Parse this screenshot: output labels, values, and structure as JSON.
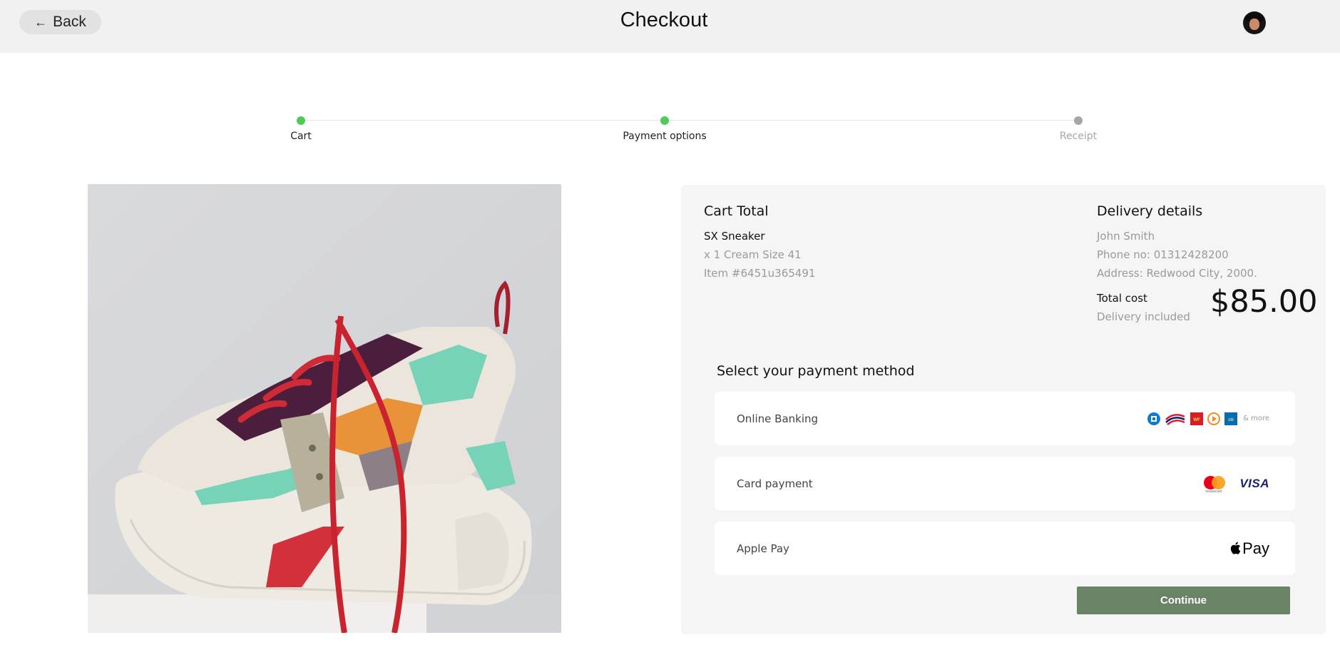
{
  "header": {
    "back_label": "Back",
    "title": "Checkout",
    "avatar_icon": "user-avatar"
  },
  "stepper": {
    "steps": [
      {
        "label": "Cart",
        "status": "complete"
      },
      {
        "label": "Payment options",
        "status": "complete"
      },
      {
        "label": "Receipt",
        "status": "pending"
      }
    ],
    "complete_color": "#4fcb57",
    "pending_color": "#a6a6a6"
  },
  "product_image": {
    "icon": "sneaker-photo"
  },
  "cart": {
    "title": "Cart Total",
    "product_name": "SX Sneaker",
    "variant": "x 1 Cream Size 41",
    "item_number": "Item #6451u365491"
  },
  "delivery": {
    "title": "Delivery details",
    "name": "John Smith",
    "phone": "Phone no: 01312428200",
    "address": "Address: Redwood City, 2000."
  },
  "total": {
    "label": "Total cost",
    "note": "Delivery included",
    "amount": "$85.00"
  },
  "payment": {
    "title": "Select your payment method",
    "methods": [
      {
        "label": "Online Banking",
        "logos": [
          "chase-icon",
          "bank-of-america-icon",
          "wells-fargo-icon",
          "orange-bank-icon",
          "citi-icon"
        ],
        "more": "& more"
      },
      {
        "label": "Card payment",
        "logos": [
          "mastercard-icon",
          "visa-icon"
        ],
        "mastercard_sub": "mastercard",
        "visa_text": "VISA"
      },
      {
        "label": "Apple Pay",
        "logos": [
          "apple-pay-icon"
        ],
        "pay_text": "Pay"
      }
    ]
  },
  "actions": {
    "continue_label": "Continue",
    "continue_color": "#6a8266"
  }
}
